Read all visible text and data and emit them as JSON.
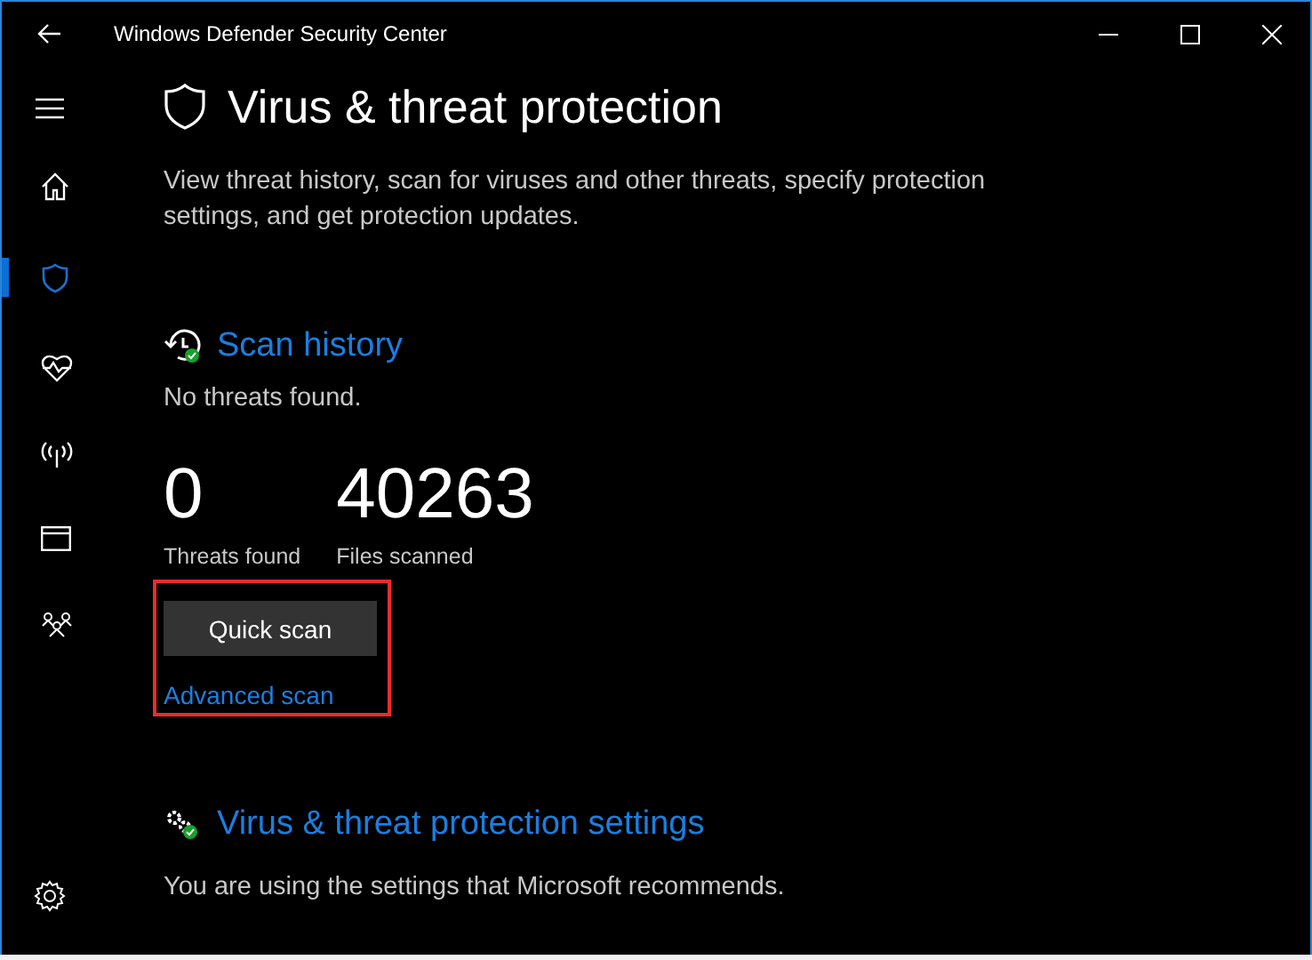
{
  "window": {
    "title": "Windows Defender Security Center"
  },
  "sidebar": {
    "items": [
      {
        "kind": "home",
        "selected": false
      },
      {
        "kind": "shield",
        "selected": true
      },
      {
        "kind": "heart",
        "selected": false
      },
      {
        "kind": "antenna",
        "selected": false
      },
      {
        "kind": "browser",
        "selected": false
      },
      {
        "kind": "family",
        "selected": false
      }
    ]
  },
  "page": {
    "title": "Virus & threat protection",
    "description": "View threat history, scan for viruses and other threats, specify protection settings, and get protection updates."
  },
  "scan_history": {
    "heading": "Scan history",
    "status": "No threats found.",
    "stats": [
      {
        "value": "0",
        "label": "Threats found"
      },
      {
        "value": "40263",
        "label": "Files scanned"
      }
    ],
    "button": "Quick scan",
    "link": "Advanced scan"
  },
  "settings_section": {
    "heading": "Virus & threat protection settings",
    "description": "You are using the settings that Microsoft recommends."
  }
}
